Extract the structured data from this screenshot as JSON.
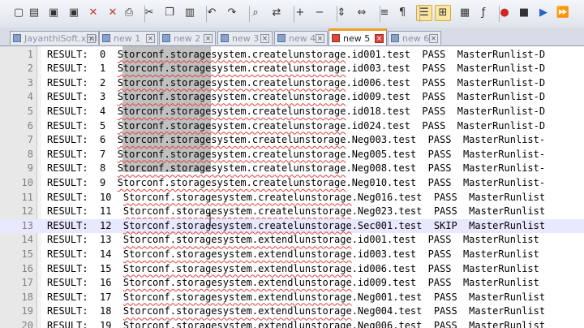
{
  "toolbar": {
    "buttons": [
      {
        "icon": "new-file-icon",
        "glyph": "▢"
      },
      {
        "icon": "open-folder-icon",
        "glyph": "▤"
      },
      {
        "icon": "save-icon",
        "glyph": "▣"
      },
      {
        "icon": "save-all-icon",
        "glyph": "▣"
      },
      {
        "icon": "close-file-icon",
        "glyph": "✕"
      },
      {
        "icon": "close-all-icon",
        "glyph": "✕"
      },
      {
        "icon": "print-icon",
        "glyph": "⎙"
      },
      {
        "icon": "cut-icon",
        "glyph": "✂"
      },
      {
        "icon": "copy-icon",
        "glyph": "❐"
      },
      {
        "icon": "paste-icon",
        "glyph": "▥"
      },
      {
        "icon": "undo-icon",
        "glyph": "↶"
      },
      {
        "icon": "redo-icon",
        "glyph": "↷"
      },
      {
        "icon": "find-icon",
        "glyph": "⌕"
      },
      {
        "icon": "replace-icon",
        "glyph": "⇄"
      },
      {
        "icon": "zoom-in-icon",
        "glyph": "+"
      },
      {
        "icon": "zoom-out-icon",
        "glyph": "−"
      },
      {
        "icon": "sync-vertical-icon",
        "glyph": "⇕"
      },
      {
        "icon": "sync-horizontal-icon",
        "glyph": "⇔"
      },
      {
        "icon": "word-wrap-icon",
        "glyph": "≡"
      },
      {
        "icon": "show-all-characters-icon",
        "glyph": "¶"
      },
      {
        "icon": "indent-guide-icon",
        "glyph": "☰"
      },
      {
        "icon": "language-icon",
        "glyph": "⊞"
      },
      {
        "icon": "doc-map-icon",
        "glyph": "▦"
      },
      {
        "icon": "function-list-icon",
        "glyph": "ƒ"
      },
      {
        "icon": "record-macro-icon",
        "glyph": "●"
      },
      {
        "icon": "stop-macro-icon",
        "glyph": "■"
      },
      {
        "icon": "play-macro-icon",
        "glyph": "▶"
      },
      {
        "icon": "run-macro-multiple-icon",
        "glyph": "⏩"
      },
      {
        "icon": "save-macro-icon",
        "glyph": "▣"
      }
    ]
  },
  "tabs": [
    {
      "label": "JayanthiSoft.xml",
      "active": false
    },
    {
      "label": "new  1",
      "active": false
    },
    {
      "label": "new  2",
      "active": false
    },
    {
      "label": "new  3",
      "active": false
    },
    {
      "label": "new  4",
      "active": false
    },
    {
      "label": "new  5",
      "active": true
    },
    {
      "label": "new  6",
      "active": false
    }
  ],
  "colors": {
    "selection": "#c0c0c0",
    "current_line": "#e8e8ff",
    "active_tab_accent": "#f59f2a",
    "spell_squiggle": "#e04040"
  },
  "lines": [
    {
      "num": "1",
      "prefix": "RESULT:  0  ",
      "path": "Storconf.storagesystem.createlunstorage",
      "suffix": ".id001.test  PASS  MasterRunlist-D"
    },
    {
      "num": "2",
      "prefix": "RESULT:  1  ",
      "path": "Storconf.storagesystem.createlunstorage",
      "suffix": ".id003.test  PASS  MasterRunlist-D"
    },
    {
      "num": "3",
      "prefix": "RESULT:  2  ",
      "path": "Storconf.storagesystem.createlunstorage",
      "suffix": ".id006.test  PASS  MasterRunlist-D"
    },
    {
      "num": "4",
      "prefix": "RESULT:  3  ",
      "path": "Storconf.storagesystem.createlunstorage",
      "suffix": ".id009.test  PASS  MasterRunlist-D"
    },
    {
      "num": "5",
      "prefix": "RESULT:  4  ",
      "path": "Storconf.storagesystem.createlunstorage",
      "suffix": ".id018.test  PASS  MasterRunlist-D"
    },
    {
      "num": "6",
      "prefix": "RESULT:  5  ",
      "path": "Storconf.storagesystem.createlunstorage",
      "suffix": ".id024.test  PASS  MasterRunlist-D"
    },
    {
      "num": "7",
      "prefix": "RESULT:  6  ",
      "path": "Storconf.storagesystem.createlunstorage",
      "suffix": ".Neg003.test  PASS  MasterRunlist-"
    },
    {
      "num": "8",
      "prefix": "RESULT:  7  ",
      "path": "Storconf.storagesystem.createlunstorage",
      "suffix": ".Neg005.test  PASS  MasterRunlist-"
    },
    {
      "num": "9",
      "prefix": "RESULT:  8  ",
      "path": "Storconf.storagesystem.createlunstorage",
      "suffix": ".Neg008.test  PASS  MasterRunlist-"
    },
    {
      "num": "10",
      "prefix": "RESULT:  9  ",
      "path": "Storconf.storagesystem.createlunstorage",
      "suffix": ".Neg010.test  PASS  MasterRunlist-"
    },
    {
      "num": "11",
      "prefix": "RESULT:  10  ",
      "path": "Storconf.storagesystem.createlunstorage",
      "suffix": ".Neg016.test  PASS  MasterRunlist"
    },
    {
      "num": "12",
      "prefix": "RESULT:  11  ",
      "path": "Storconf.storagesystem.createlunstorage",
      "suffix": ".Neg023.test  PASS  MasterRunlist"
    },
    {
      "num": "13",
      "prefix": "RESULT:  12  ",
      "path": "Storconf.storagesystem.createlunstorage",
      "suffix": ".Sec001.test  SKIP  MasterRunlist"
    },
    {
      "num": "14",
      "prefix": "RESULT:  13  ",
      "path": "Storconf.storagesystem.extendlunstorage",
      "suffix": ".id001.test  PASS  MasterRunlist"
    },
    {
      "num": "15",
      "prefix": "RESULT:  14  ",
      "path": "Storconf.storagesystem.extendlunstorage",
      "suffix": ".id003.test  PASS  MasterRunlist"
    },
    {
      "num": "16",
      "prefix": "RESULT:  15  ",
      "path": "Storconf.storagesystem.extendlunstorage",
      "suffix": ".id006.test  PASS  MasterRunlist"
    },
    {
      "num": "17",
      "prefix": "RESULT:  16  ",
      "path": "Storconf.storagesystem.extendlunstorage",
      "suffix": ".id009.test  PASS  MasterRunlist"
    },
    {
      "num": "18",
      "prefix": "RESULT:  17  ",
      "path": "Storconf.storagesystem.extendlunstorage",
      "suffix": ".Neg001.test  PASS  MasterRunlist"
    },
    {
      "num": "19",
      "prefix": "RESULT:  18  ",
      "path": "Storconf.storagesystem.extendlunstorage",
      "suffix": ".Neg004.test  PASS  MasterRunlist"
    },
    {
      "num": "20",
      "prefix": "RESULT:  19  ",
      "path": "Storconf.storagesystem.extendlunstorage",
      "suffix": ".Neg006.test  PASS  MasterRunlist"
    }
  ],
  "current_line": "13"
}
